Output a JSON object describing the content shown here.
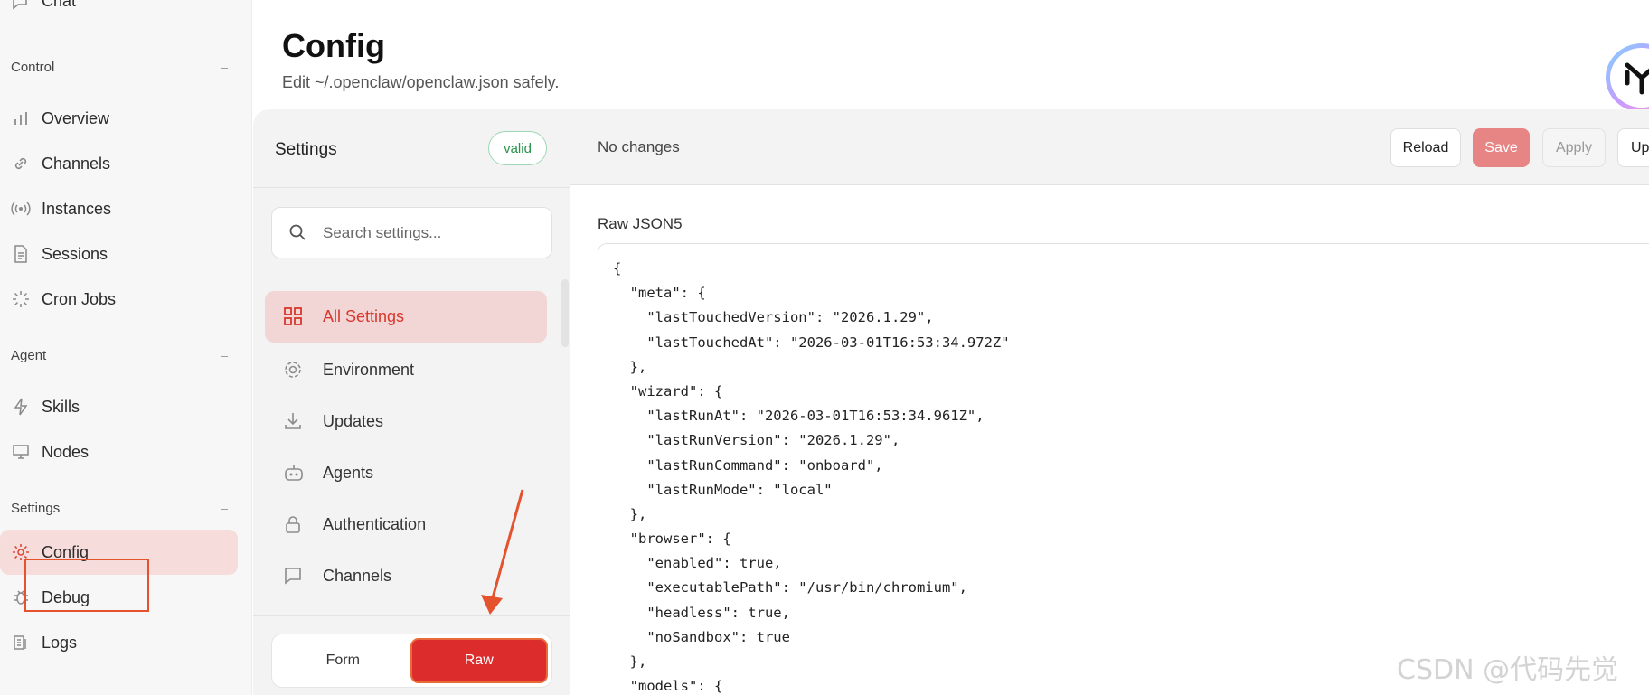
{
  "nav": {
    "partial_top_label": "Chat",
    "groups": [
      {
        "title": "Control",
        "collapse": "–"
      },
      {
        "title": "Agent",
        "collapse": "–"
      },
      {
        "title": "Settings",
        "collapse": "–"
      }
    ],
    "items": [
      {
        "label": "Overview",
        "icon": "bar-chart-icon"
      },
      {
        "label": "Channels",
        "icon": "link-icon"
      },
      {
        "label": "Instances",
        "icon": "radio-icon"
      },
      {
        "label": "Sessions",
        "icon": "document-icon"
      },
      {
        "label": "Cron Jobs",
        "icon": "loader-icon"
      },
      {
        "label": "Skills",
        "icon": "lightning-icon"
      },
      {
        "label": "Nodes",
        "icon": "monitor-icon"
      },
      {
        "label": "Config",
        "icon": "gear-icon",
        "active": true
      },
      {
        "label": "Debug",
        "icon": "bug-icon"
      },
      {
        "label": "Logs",
        "icon": "logs-icon"
      }
    ]
  },
  "header": {
    "title": "Config",
    "subtitle": "Edit ~/.openclaw/openclaw.json safely."
  },
  "settings": {
    "title": "Settings",
    "status_badge": "valid",
    "search_placeholder": "Search settings...",
    "sections": [
      {
        "label": "All Settings",
        "icon": "grid-icon",
        "active": true
      },
      {
        "label": "Environment",
        "icon": "gear-icon"
      },
      {
        "label": "Updates",
        "icon": "download-icon"
      },
      {
        "label": "Agents",
        "icon": "robot-icon"
      },
      {
        "label": "Authentication",
        "icon": "lock-icon"
      },
      {
        "label": "Channels",
        "icon": "chat-icon"
      }
    ],
    "mode": {
      "form": "Form",
      "raw": "Raw",
      "selected": "Raw"
    }
  },
  "toolbar": {
    "changes": "No changes",
    "reload": "Reload",
    "save": "Save",
    "apply": "Apply",
    "update_partial": "Up"
  },
  "editor": {
    "label": "Raw JSON5",
    "lines": [
      "{",
      "  \"meta\": {",
      "    \"lastTouchedVersion\": \"2026.1.29\",",
      "    \"lastTouchedAt\": \"2026-03-01T16:53:34.972Z\"",
      "  },",
      "  \"wizard\": {",
      "    \"lastRunAt\": \"2026-03-01T16:53:34.961Z\",",
      "    \"lastRunVersion\": \"2026.1.29\",",
      "    \"lastRunCommand\": \"onboard\",",
      "    \"lastRunMode\": \"local\"",
      "  },",
      "  \"browser\": {",
      "    \"enabled\": true,",
      "    \"executablePath\": \"/usr/bin/chromium\",",
      "    \"headless\": true,",
      "    \"noSandbox\": true",
      "  },",
      "  \"models\": {"
    ]
  },
  "watermark": "CSDN @代码先觉",
  "colors": {
    "accent": "#d8372b",
    "active_bg": "#f2d6d6",
    "raw_button": "#dc2c2c",
    "annotation": "#e4522e"
  }
}
